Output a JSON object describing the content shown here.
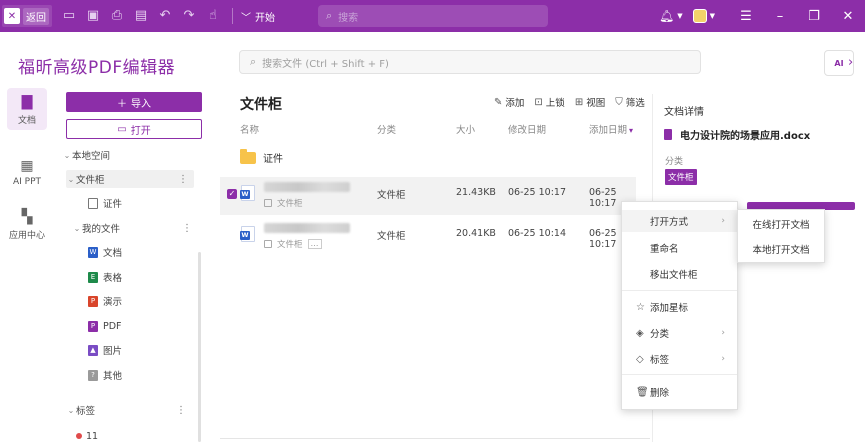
{
  "titlebar": {
    "back_label": "返回",
    "start_label": "开始",
    "search_placeholder": "搜索"
  },
  "header": {
    "app_title": "福昕高级PDF编辑器",
    "search_placeholder": "搜索文件 (Ctrl + Shift + F)",
    "ai_badge": "AI"
  },
  "rail": {
    "items": [
      {
        "label": "文档",
        "icon": "document-icon"
      },
      {
        "label": "AI PPT",
        "icon": "ai-ppt-icon"
      },
      {
        "label": "应用中心",
        "icon": "apps-icon"
      }
    ]
  },
  "nav": {
    "import_label": "导入",
    "open_label": "打开",
    "local_space": "本地空间",
    "cabinet": "文件柜",
    "certificates": "证件",
    "my_files": "我的文件",
    "types": [
      {
        "label": "文档",
        "color": "#2b5fc8",
        "glyph": "W"
      },
      {
        "label": "表格",
        "color": "#1e8a4a",
        "glyph": "E"
      },
      {
        "label": "演示",
        "color": "#d9452b",
        "glyph": "P"
      },
      {
        "label": "PDF",
        "color": "#8c2ea8",
        "glyph": "P"
      },
      {
        "label": "图片",
        "color": "#7a4cc4",
        "glyph": "▲"
      },
      {
        "label": "其他",
        "color": "#9a9a9a",
        "glyph": "?"
      }
    ],
    "tags_label": "标签",
    "tag_item": "11",
    "tag_color": "#e04b4b"
  },
  "list": {
    "title": "文件柜",
    "actions": [
      "添加",
      "上锁",
      "视图",
      "筛选"
    ],
    "columns": {
      "name": "名称",
      "category": "分类",
      "size": "大小",
      "modified": "修改日期",
      "added": "添加日期"
    },
    "folder": "证件",
    "files": [
      {
        "category": "文件柜",
        "size": "21.43KB",
        "modified": "06-25 10:17",
        "added": "06-25 10:17",
        "subtitle": "文件柜",
        "selected": true
      },
      {
        "category": "文件柜",
        "size": "20.41KB",
        "modified": "06-25 10:14",
        "added": "06-25 10:17",
        "subtitle": "文件柜",
        "selected": false
      }
    ]
  },
  "details": {
    "title": "文档详情",
    "filename": "电力设计院的场景应用.docx",
    "category_label": "分类",
    "category_value": "文件柜"
  },
  "context_menu": {
    "items": [
      "打开方式",
      "重命名",
      "移出文件柜",
      "添加星标",
      "分类",
      "标签",
      "删除"
    ],
    "submenu": [
      "在线打开文档",
      "本地打开文档"
    ]
  },
  "colors": {
    "accent": "#8c2ea8"
  }
}
